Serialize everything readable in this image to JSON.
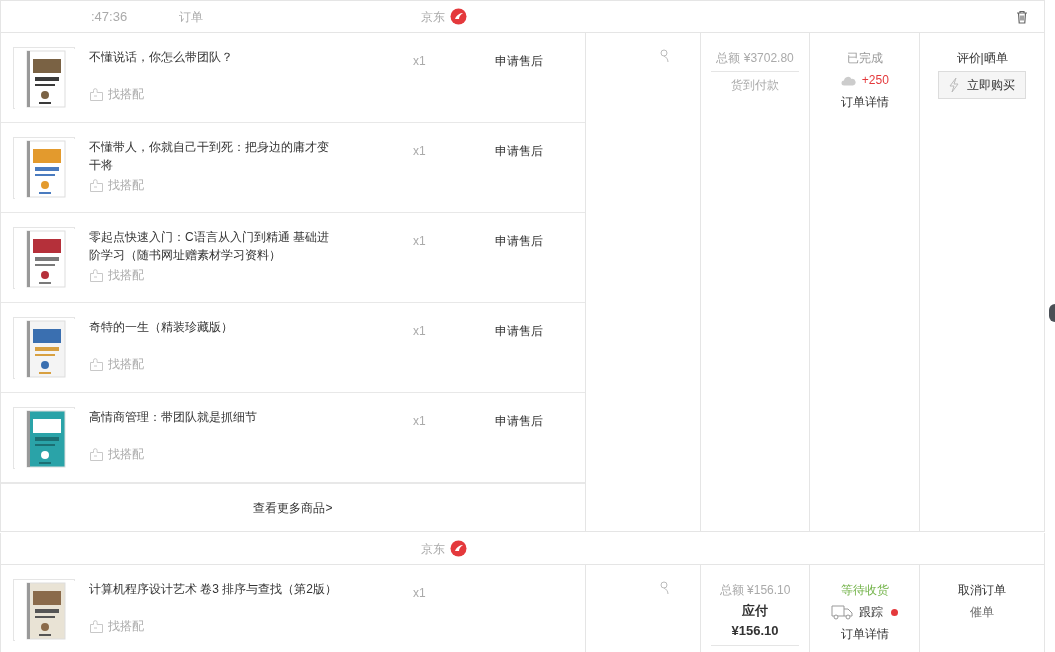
{
  "orders": [
    {
      "time": ":47:36",
      "order_label": "订单",
      "shop": "京东",
      "deletable": true,
      "items": [
        {
          "title": "不懂说话，你怎么带团队？",
          "quantity": "x1",
          "after_sale": "申请售后",
          "match": "找搭配"
        },
        {
          "title": "不懂带人，你就自己干到死：把身边的庸才变干将",
          "quantity": "x1",
          "after_sale": "申请售后",
          "match": "找搭配"
        },
        {
          "title": "零起点快速入门：C语言从入门到精通 基础进阶学习（随书网址赠素材学习资料）",
          "quantity": "x1",
          "after_sale": "申请售后",
          "match": "找搭配"
        },
        {
          "title": "奇特的一生（精装珍藏版）",
          "quantity": "x1",
          "after_sale": "申请售后",
          "match": "找搭配"
        },
        {
          "title": "高情商管理：带团队就是抓细节",
          "quantity": "x1",
          "after_sale": "申请售后",
          "match": "找搭配"
        }
      ],
      "more_link": "查看更多商品>",
      "total": "总额 ¥3702.80",
      "payment": "货到付款",
      "status": {
        "label": "已完成",
        "kind": "done"
      },
      "points": "+250",
      "detail": "订单详情",
      "actions": [
        {
          "label": "评价|晒单",
          "kind": "link"
        },
        {
          "label": "立即购买",
          "kind": "button"
        }
      ]
    },
    {
      "shop": "京东",
      "deletable": false,
      "items": [
        {
          "title": "计算机程序设计艺术 卷3 排序与查找（第2版）",
          "quantity": "x1",
          "match": "找搭配"
        }
      ],
      "total": "总额 ¥156.10",
      "payable": {
        "label": "应付",
        "amount": "¥156.10"
      },
      "status": {
        "label": "等待收货",
        "kind": "waiting"
      },
      "track": {
        "label": "跟踪",
        "unread": true
      },
      "detail": "订单详情",
      "actions": [
        {
          "label": "取消订单",
          "kind": "link"
        },
        {
          "label": "催单",
          "kind": "muted"
        }
      ]
    }
  ]
}
